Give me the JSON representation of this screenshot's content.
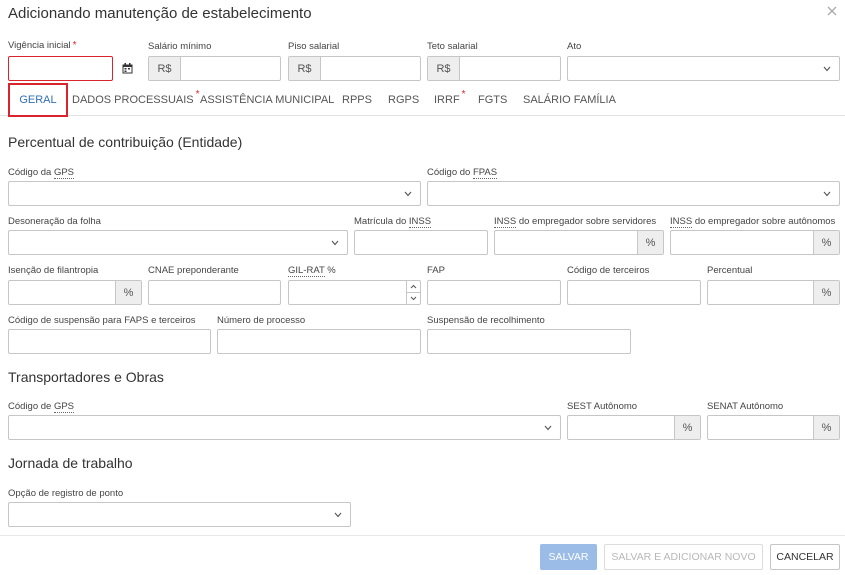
{
  "title": "Adicionando manutenção de estabelecimento",
  "top_fields": {
    "vigencia_label": "Vigência inicial",
    "salario_label": "Salário mínimo",
    "piso_label": "Piso salarial",
    "teto_label": "Teto salarial",
    "ato_label": "Ato",
    "currency": "R$"
  },
  "tabs": [
    {
      "label": "GERAL",
      "active": true
    },
    {
      "label": "DADOS PROCESSUAIS",
      "required": true
    },
    {
      "label": "ASSISTÊNCIA MUNICIPAL"
    },
    {
      "label": "RPPS"
    },
    {
      "label": "RGPS"
    },
    {
      "label": "IRRF",
      "required": true
    },
    {
      "label": "FGTS"
    },
    {
      "label": "SALÁRIO FAMÍLIA"
    }
  ],
  "required_mark": "*",
  "percent": "%",
  "section_percentual": {
    "title": "Percentual de contribuição (Entidade)",
    "codigo_gps_prefix": "Código da ",
    "codigo_gps_abbr": "GPS",
    "codigo_fpas_prefix": "Código do ",
    "codigo_fpas_abbr": "FPAS",
    "desoneracao": "Desoneração da folha",
    "matricula_prefix": "Matrícula do ",
    "matricula_abbr": "INSS",
    "inss_servidores_abbr": "INSS",
    "inss_servidores_rest": " do empregador sobre servidores",
    "inss_autonomos_abbr": "INSS",
    "inss_autonomos_rest": " do empregador sobre autônomos",
    "isencao": "Isenção de filantropia",
    "cnae": "CNAE preponderante",
    "gilrat_abbr": "GIL-RAT",
    "gilrat_rest": " %",
    "fap": "FAP",
    "codigo_terceiros": "Código de terceiros",
    "percentual": "Percentual",
    "codigo_suspensao": "Código de suspensão para FAPS e terceiros",
    "numero_processo": "Número de processo",
    "suspensao_recolhimento": "Suspensão de recolhimento"
  },
  "section_transportadores": {
    "title": "Transportadores e Obras",
    "codigo_gps_prefix": "Código de ",
    "codigo_gps_abbr": "GPS",
    "sest": "SEST Autônomo",
    "senat": "SENAT Autônomo"
  },
  "section_jornada": {
    "title": "Jornada de trabalho",
    "opcao_registro": "Opção de registro de ponto"
  },
  "footer": {
    "salvar": "SALVAR",
    "salvar_novo": "SALVAR E ADICIONAR NOVO",
    "cancelar": "CANCELAR"
  },
  "colors": {
    "error": "#d9232d",
    "active_tab": "#2f6fb6",
    "primary_button": "#9bbce6"
  }
}
